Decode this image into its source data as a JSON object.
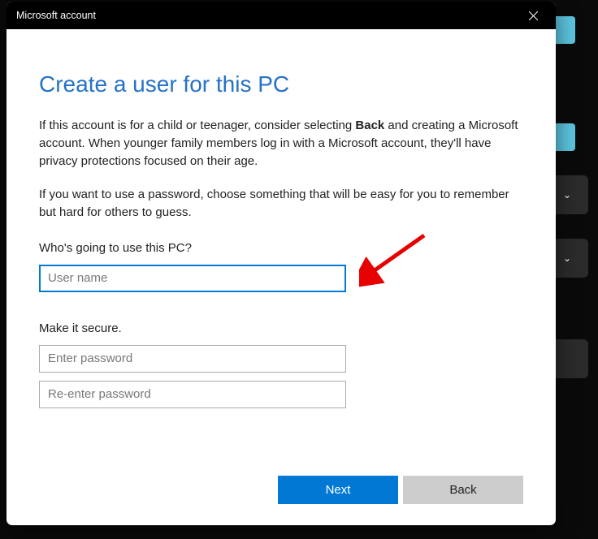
{
  "window": {
    "title": "Microsoft account"
  },
  "heading": "Create a user for this PC",
  "para1_pre": "If this account is for a child or teenager, consider selecting ",
  "para1_bold": "Back",
  "para1_post": " and creating a Microsoft account. When younger family members log in with a Microsoft account, they'll have privacy protections focused on their age.",
  "para2": "If you want to use a password, choose something that will be easy for you to remember but hard for others to guess.",
  "section_user_label": "Who's going to use this PC?",
  "section_secure_label": "Make it secure.",
  "fields": {
    "username_placeholder": "User name",
    "password_placeholder": "Enter password",
    "password2_placeholder": "Re-enter password"
  },
  "buttons": {
    "next": "Next",
    "back": "Back"
  }
}
